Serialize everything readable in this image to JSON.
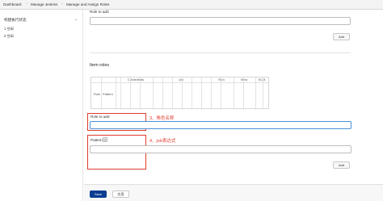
{
  "breadcrumb": {
    "items": [
      "Dashboard",
      "Manage Jenkins",
      "Manage and Assign Roles"
    ]
  },
  "sidebar": {
    "title": "构建执行状态",
    "items": [
      "1  空闲",
      "2  空闲"
    ]
  },
  "global_roles": {
    "role_to_add_label": "Role to add",
    "role_value": "",
    "add_label": "Add"
  },
  "item_roles": {
    "title": "Item roles",
    "matrix": {
      "groups": [
        "Credentials",
        "Job",
        "Run",
        "View",
        "SCM"
      ],
      "row_headers": [
        "Role",
        "Pattern"
      ]
    },
    "role_to_add_label": "Role to add",
    "role_value": "",
    "pattern_label": "Pattern",
    "pattern_value": "",
    "help_glyph": "?",
    "add_label": "Add"
  },
  "annotations": {
    "role_note": "3、角色名称",
    "pattern_note": "4、job表达式",
    "color": "#e03b2e"
  },
  "footer": {
    "save_label": "Save",
    "apply_label": "应用"
  },
  "colors": {
    "save_button": "#0b3d91",
    "focus_border": "#4a90d9"
  }
}
